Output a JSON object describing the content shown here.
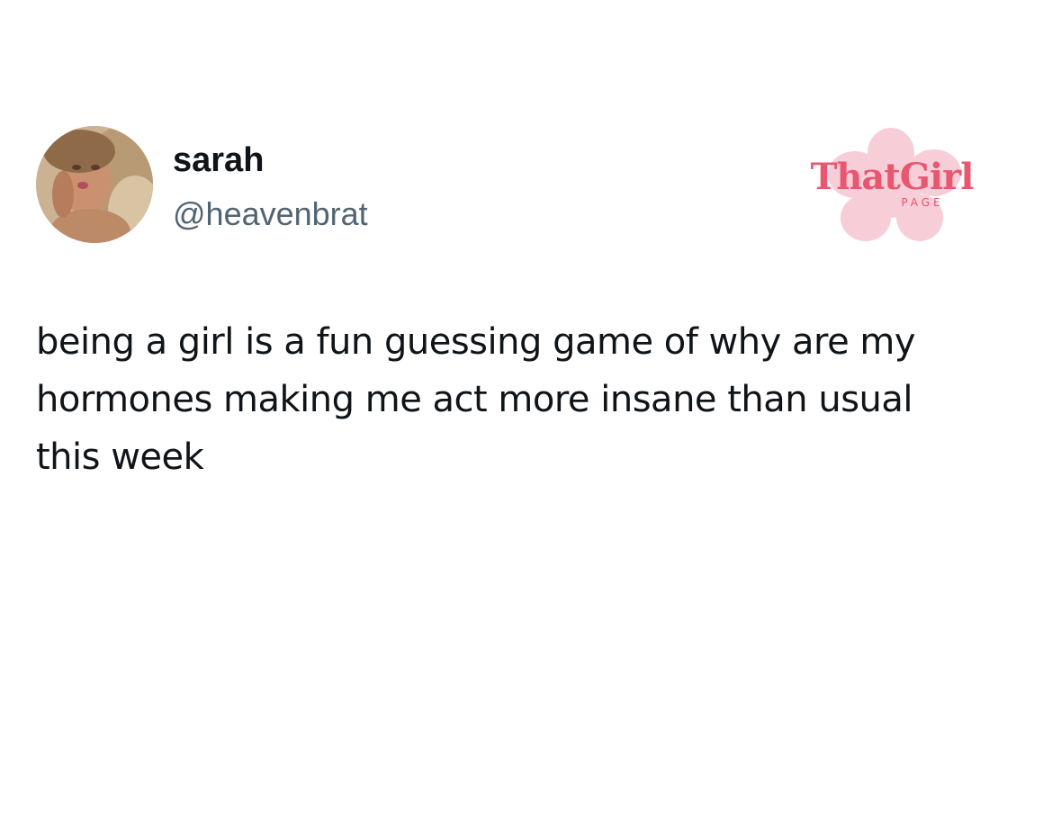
{
  "tweet": {
    "author": {
      "display_name": "sarah",
      "handle": "@heavenbrat",
      "avatar_icon": "profile-photo"
    },
    "text_lines": [
      "being a girl is a fun guessing game of why are my",
      "hormones making me act more insane than usual",
      "this week"
    ]
  },
  "watermark": {
    "title": "ThatGirl",
    "subtitle": "PAGE",
    "icon": "flower-icon"
  },
  "colors": {
    "background": "#ffffff",
    "text_primary": "#0f1419",
    "text_secondary": "#536471",
    "watermark_text": "#e8566f",
    "watermark_flower": "#f7cdd8"
  }
}
